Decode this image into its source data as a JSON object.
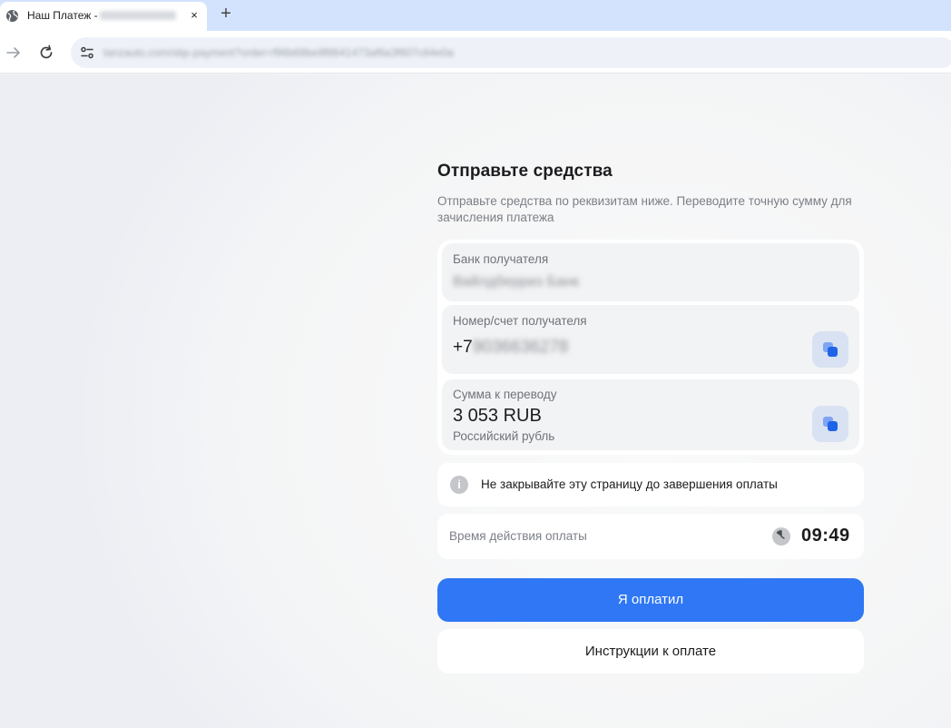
{
  "browser": {
    "tab_title": "Наш Платеж -",
    "tab_title_blurred": "Ф8607-29-391",
    "close_glyph": "×",
    "new_tab_glyph": "+",
    "url": "tanzauto.com/sbp-payment?order=f96b68be9f8641473af6a3f607c64e0a"
  },
  "payment": {
    "title": "Отправьте средства",
    "subtitle": "Отправьте средства по реквизитам ниже. Переводите точную сумму для зачисления платежа",
    "bank": {
      "label": "Банк получателя",
      "value": "Вайлдберриз Банк"
    },
    "account": {
      "label": "Номер/счет получателя",
      "value_prefix": "+7",
      "value_hidden": "9036636278"
    },
    "amount": {
      "label": "Сумма к переводу",
      "value": "3 053 RUB",
      "currency_name": "Российский рубль"
    },
    "warning": {
      "icon_glyph": "i",
      "text": "Не закрывайте эту страницу до завершения оплаты"
    },
    "timer": {
      "label": "Время действия оплаты",
      "value": "09:49"
    },
    "paid_button": "Я оплатил",
    "instructions_button": "Инструкции к оплате"
  },
  "colors": {
    "primary": "#2f77f5",
    "copy_icon": "#1f64e8",
    "tabbar": "#d3e3fd"
  },
  "icons": {
    "tab_favicon": "globe-icon",
    "forward": "arrow-right-icon",
    "reload": "reload-icon",
    "site_info": "tune-icon",
    "copy": "copy-icon",
    "info": "info-icon",
    "clock": "clock-icon"
  }
}
